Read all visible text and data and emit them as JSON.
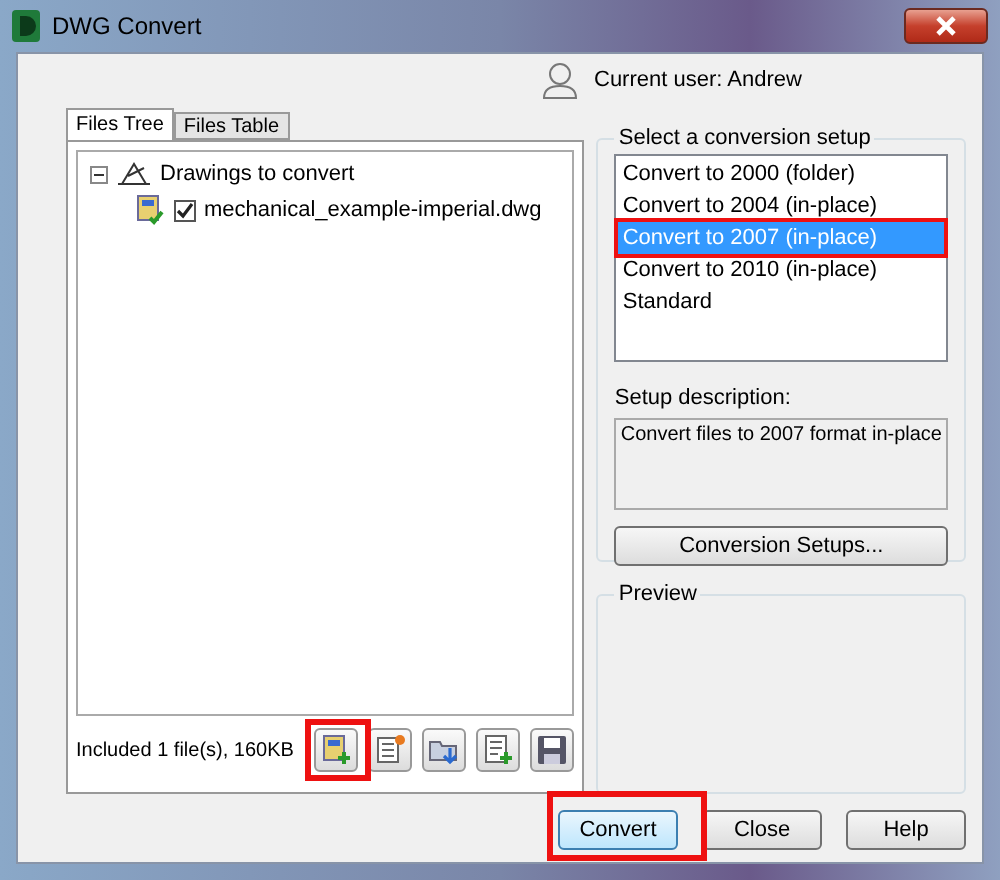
{
  "window": {
    "title": "DWG Convert"
  },
  "user": {
    "label": "Current user: Andrew"
  },
  "tabs": [
    {
      "label": "Files Tree",
      "selected": true
    },
    {
      "label": "Files Table",
      "selected": false
    }
  ],
  "tree": [
    {
      "label": "Drawings to convert",
      "expanded": true,
      "children": [
        {
          "label": "mechanical_example-imperial.dwg",
          "checked": true
        }
      ]
    }
  ],
  "status": "Included 1 file(s), 160KB",
  "setups": {
    "title": "Select a conversion setup",
    "items": [
      {
        "label": "Convert to 2000 (folder)",
        "selected": false
      },
      {
        "label": "Convert to 2004 (in-place)",
        "selected": false
      },
      {
        "label": "Convert to 2007 (in-place)",
        "selected": true
      },
      {
        "label": "Convert to 2010 (in-place)",
        "selected": false
      },
      {
        "label": "Standard",
        "selected": false
      }
    ]
  },
  "description": {
    "label": "Setup description:",
    "text": "Convert files to 2007 format in-place"
  },
  "setups_button": "Conversion Setups...",
  "preview": {
    "title": "Preview"
  },
  "buttons": [
    {
      "label": "Convert",
      "focused": true
    },
    {
      "label": "Close",
      "focused": false
    },
    {
      "label": "Help",
      "focused": false
    }
  ]
}
